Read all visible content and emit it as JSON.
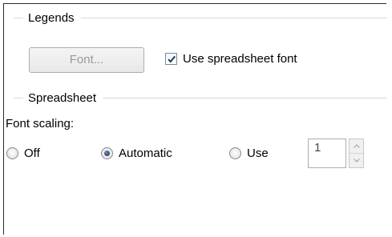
{
  "legends": {
    "title": "Legends",
    "font_button": "Font...",
    "use_spreadsheet_font_label": "Use spreadsheet font",
    "use_spreadsheet_font_checked": true
  },
  "spreadsheet": {
    "title": "Spreadsheet",
    "font_scaling_label": "Font scaling:",
    "options": {
      "off": "Off",
      "automatic": "Automatic",
      "use": "Use"
    },
    "selected": "automatic",
    "use_value": "1"
  },
  "icons": {
    "checkmark": "checkmark-icon",
    "spin_up": "chevron-up-icon",
    "spin_down": "chevron-down-icon"
  },
  "colors": {
    "rule": "#d8d8d8",
    "disabled_text": "#9a9a9a",
    "radio_fill": "#1f3f66"
  }
}
